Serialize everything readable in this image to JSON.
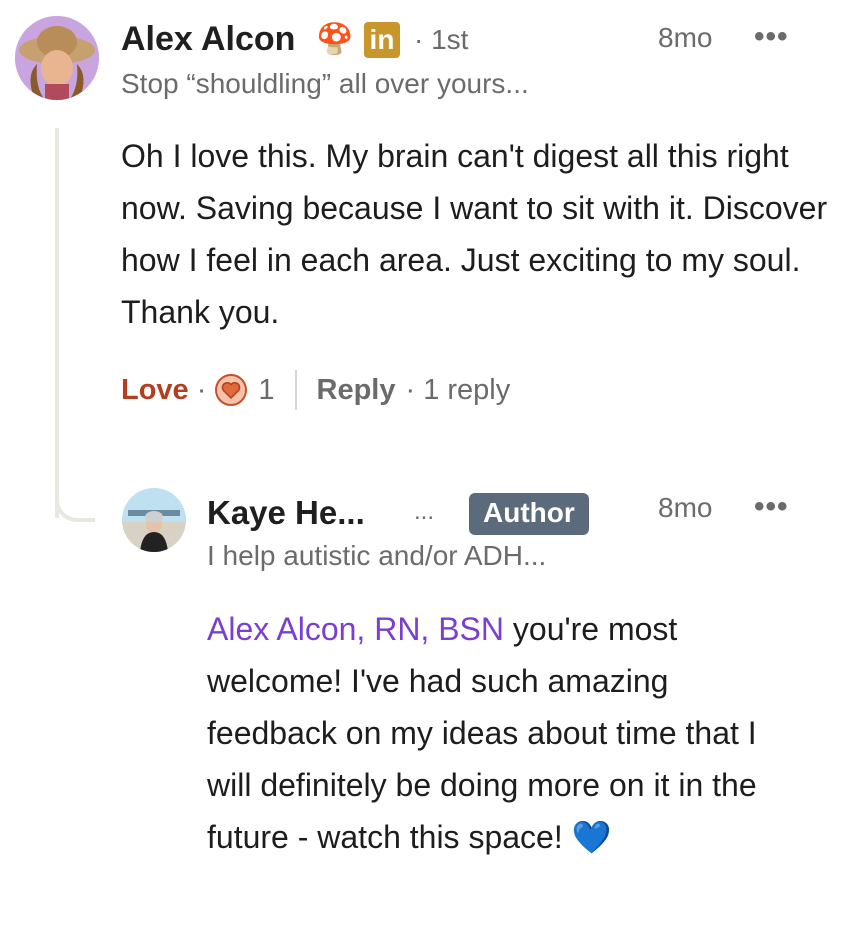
{
  "comment": {
    "author_name": "Alex Alcon",
    "author_emoji": "🍄",
    "degree": "· 1st",
    "headline": "Stop “shouldling” all over yours...",
    "time": "8mo",
    "more": "•••",
    "text": "Oh I love this. My brain can't digest all this right now. Saving because I want to sit with it. Discover how I feel in each area. Just exciting to my soul. Thank you.",
    "reaction_label": "Love",
    "dot": "·",
    "reaction_count": "1",
    "reply_label": "Reply",
    "replies_count": "· 1 reply"
  },
  "reply": {
    "author_name": "Kaye He...",
    "ellipsis": "...",
    "badge": "Author",
    "time": "8mo",
    "more": "•••",
    "headline": "I help autistic and/or ADH...",
    "mention": "Alex Alcon, RN, BSN",
    "text": " you're most welcome! I've had such amazing feedback on my ideas about time that I will definitely be doing more on it in the future - watch this space! 💙"
  },
  "colors": {
    "love": "#b24020",
    "mention": "#7a3fd0",
    "linkedin_badge": "#c9962b",
    "author_badge": "#5b6b7b"
  }
}
